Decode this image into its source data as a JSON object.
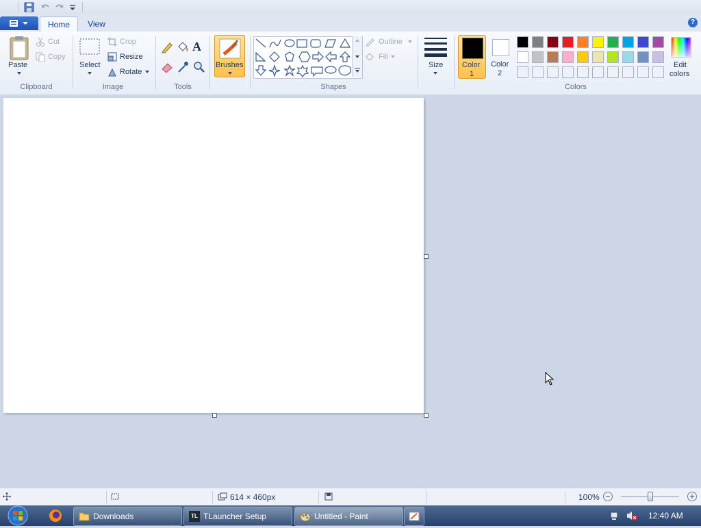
{
  "window": {
    "title": "Untitled - Paint"
  },
  "quick_access": {
    "save_icon": "save-icon",
    "undo_icon": "undo-icon",
    "redo_icon": "redo-icon",
    "customize_icon": "chevron-down-icon"
  },
  "tabs": [
    {
      "label": "Home"
    },
    {
      "label": "View"
    }
  ],
  "clipboard": {
    "paste": "Paste",
    "cut": "Cut",
    "copy": "Copy",
    "group": "Clipboard"
  },
  "image": {
    "select": "Select",
    "crop": "Crop",
    "resize": "Resize",
    "rotate": "Rotate",
    "group": "Image"
  },
  "tools": {
    "group": "Tools"
  },
  "brushes": {
    "label": "Brushes"
  },
  "shapes": {
    "group": "Shapes",
    "outline": "Outline",
    "fill": "Fill"
  },
  "size": {
    "label": "Size"
  },
  "colors": {
    "color1_label": "Color",
    "color1_num": "1",
    "color2_label": "Color",
    "color2_num": "2",
    "edit_label": "Edit",
    "edit_label2": "colors",
    "group": "Colors",
    "color1_value": "#000000",
    "color2_value": "#ffffff",
    "palette_row1": [
      "#000000",
      "#7f7f7f",
      "#880015",
      "#ed1c24",
      "#ff7f27",
      "#fff200",
      "#22b14c",
      "#00a2e8",
      "#3f48cc",
      "#a349a4"
    ],
    "palette_row2": [
      "#ffffff",
      "#c3c3c3",
      "#b97a57",
      "#ffaec9",
      "#ffc90e",
      "#efe4b0",
      "#b5e61d",
      "#99d9ea",
      "#7092be",
      "#c8bfe7"
    ]
  },
  "status": {
    "canvas_size": "614 × 460px",
    "zoom": "100%"
  },
  "taskbar": {
    "items": [
      {
        "label": "Downloads"
      },
      {
        "label": "TLauncher Setup"
      },
      {
        "label": "Untitled - Paint"
      }
    ],
    "clock": "12:40 AM"
  }
}
